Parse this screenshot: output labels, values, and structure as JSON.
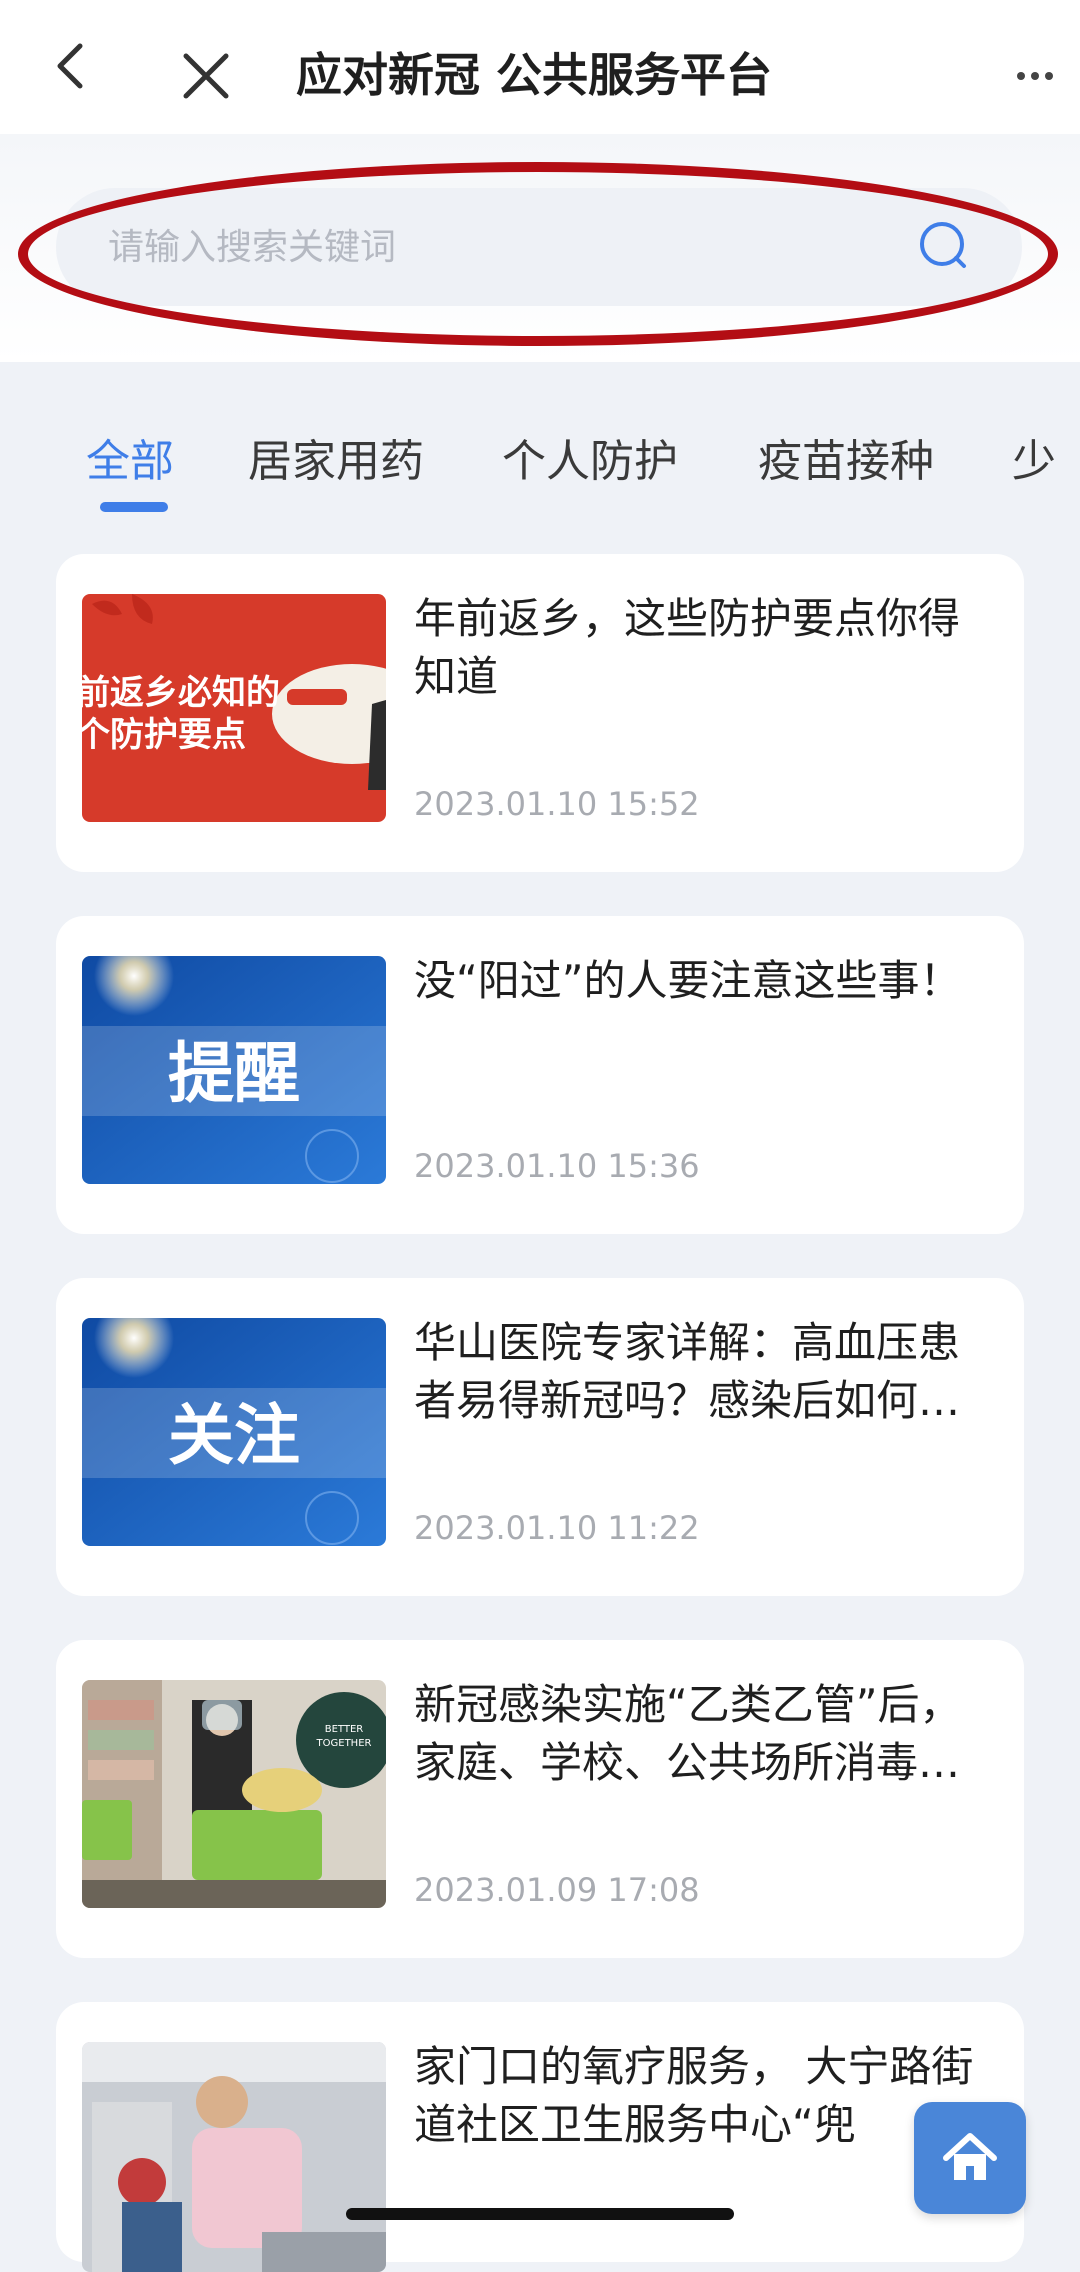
{
  "header": {
    "title": "应对新冠 公共服务平台",
    "back_icon": "chevron-left-icon",
    "close_icon": "close-icon",
    "more_icon": "more-horizontal-icon"
  },
  "search": {
    "placeholder": "请输入搜索关键词",
    "value": "",
    "icon": "search-icon"
  },
  "tabs": [
    {
      "label": "全部",
      "active": true
    },
    {
      "label": "居家用药",
      "active": false
    },
    {
      "label": "个人防护",
      "active": false
    },
    {
      "label": "疫苗接种",
      "active": false
    },
    {
      "label": "少",
      "active": false
    }
  ],
  "articles": [
    {
      "title": "年前返乡，这些防护要点你得知道",
      "date": "2023.01.10 15:52",
      "thumb_text": [
        "前返乡必知的",
        "个防护要点"
      ],
      "thumb_color": "#d63a2a"
    },
    {
      "title": "没“阳过”的人要注意这些事！",
      "date": "2023.01.10 15:36",
      "thumb_text": "提醒",
      "thumb_color": "#1f5fb8"
    },
    {
      "title": "华山医院专家详解：高血压患者易得新冠吗？感染后如何用药？",
      "date": "2023.01.10 11:22",
      "thumb_text": "关注",
      "thumb_color": "#1f5fb8"
    },
    {
      "title": "新冠感染实施“乙类乙管”后，家庭、学校、公共场所消毒怎么做？",
      "date": "2023.01.09 17:08",
      "thumb_text": [
        "BETTER",
        "TOGETHER"
      ],
      "thumb_color": "#8a7e72"
    },
    {
      "title": "家门口的氧疗服务， 大宁路街道社区卫生服务中心“兜",
      "date": "",
      "thumb_color": "#c9cdd3"
    }
  ],
  "fab": {
    "icon": "home-icon"
  },
  "colors": {
    "accent": "#3f7ee8",
    "annotation_red": "#b30d14",
    "background": "#eff2f7"
  }
}
